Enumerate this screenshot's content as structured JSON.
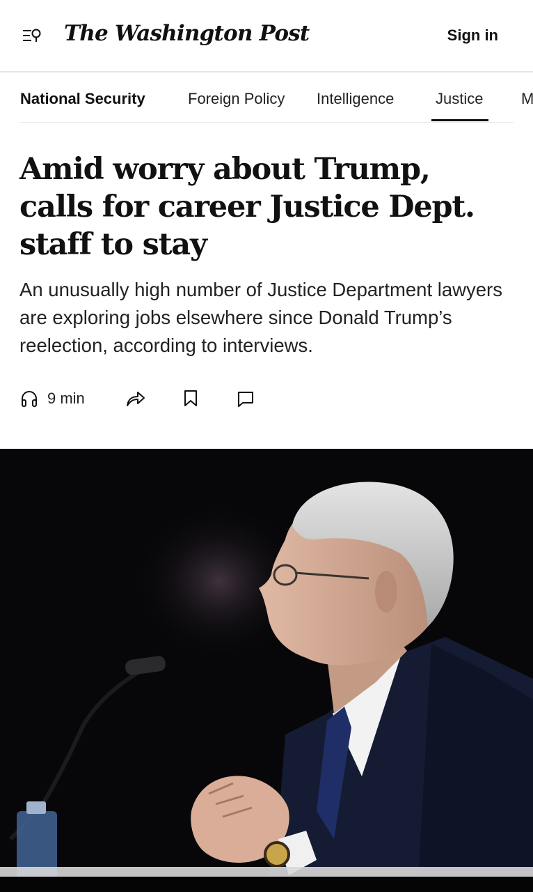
{
  "header": {
    "masthead": "The Washington Post",
    "sign_in_label": "Sign in",
    "menu_icon": "menu-search-icon"
  },
  "nav": {
    "section_title": "National Security",
    "items": [
      "Foreign Policy",
      "Intelligence",
      "Justice",
      "M"
    ],
    "active_item": "Justice"
  },
  "article": {
    "headline": "Amid worry about Trump, calls for career Justice Dept. staff to stay",
    "dek": "An unusually high number of Justice Department lawyers are exploring jobs elsewhere since Donald Trump’s reelection, according to interviews.",
    "listen_time": "9 min",
    "action_icons": [
      "headphones-icon",
      "share-icon",
      "bookmark-icon",
      "comment-icon"
    ]
  },
  "colors": {
    "text": "#111111",
    "divider": "#e6e6e6",
    "photo_background": "#070709"
  }
}
